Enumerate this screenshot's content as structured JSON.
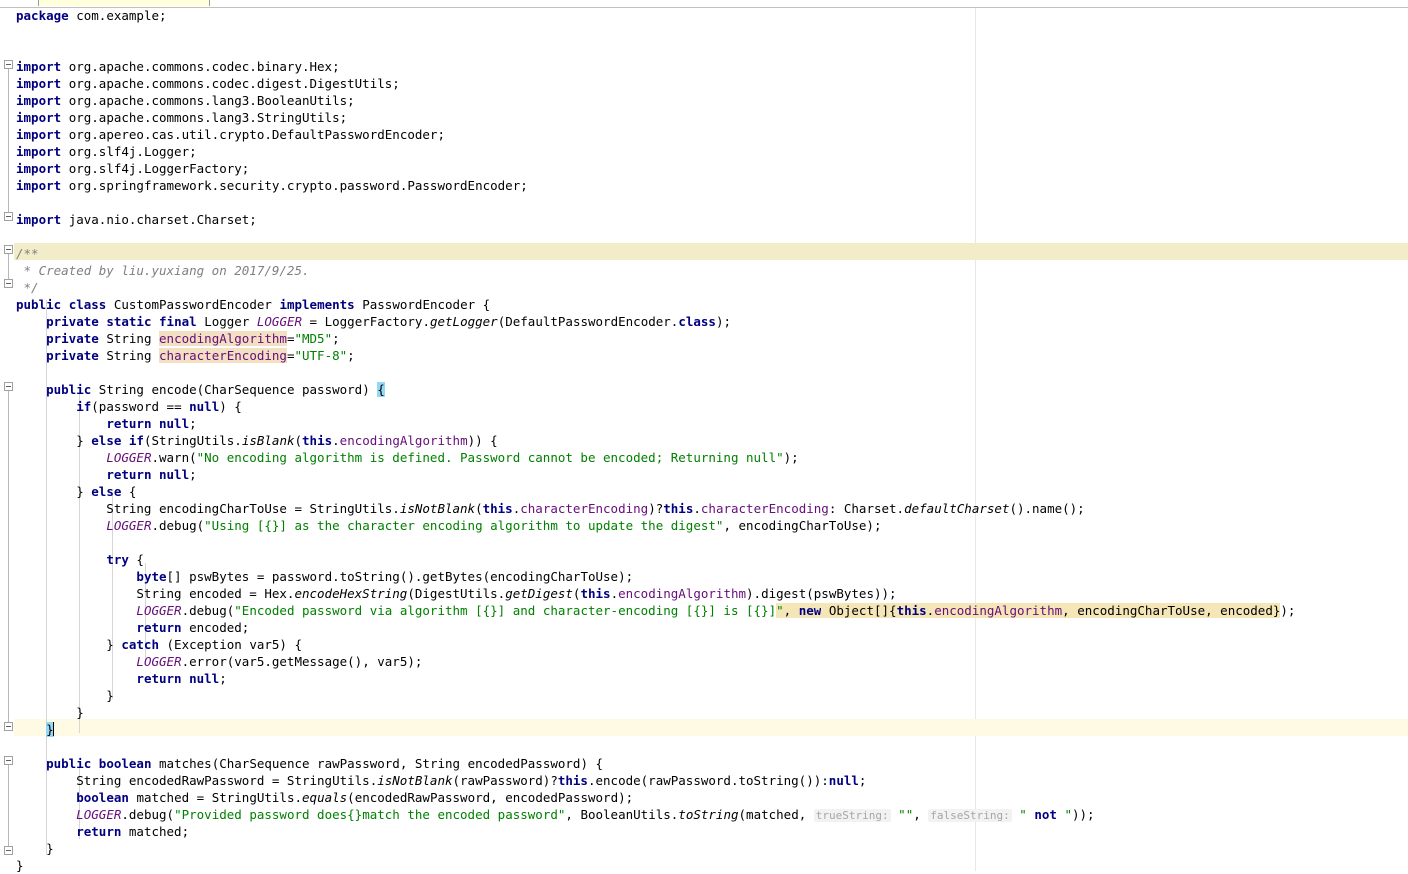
{
  "editor": {
    "app": "IntelliJ IDEA Java Editor",
    "file": "CustomPasswordEncoder.java",
    "language": "java",
    "margin_guide_column_x": 975,
    "colors": {
      "background": "#ffffff",
      "keyword": "#000080",
      "string": "#008000",
      "field": "#660e7a",
      "comment": "#808080",
      "doc_highlight": "#f2ecc9",
      "caret_line": "#fffae3",
      "field_identifier_highlight": "#f3dfc1",
      "selection_highlight": "#f5e6b8",
      "brace_match": "#93d9f5",
      "gutter_fold_line": "#b8b8b8",
      "indent_guide": "#d6d6d6"
    }
  },
  "code": {
    "lines": [
      {
        "id": 1,
        "text": "package com.example;"
      },
      {
        "id": 2,
        "text": ""
      },
      {
        "id": 3,
        "text": ""
      },
      {
        "id": 4,
        "text": "import org.apache.commons.codec.binary.Hex;"
      },
      {
        "id": 5,
        "text": "import org.apache.commons.codec.digest.DigestUtils;"
      },
      {
        "id": 6,
        "text": "import org.apache.commons.lang3.BooleanUtils;"
      },
      {
        "id": 7,
        "text": "import org.apache.commons.lang3.StringUtils;"
      },
      {
        "id": 8,
        "text": "import org.apereo.cas.util.crypto.DefaultPasswordEncoder;"
      },
      {
        "id": 9,
        "text": "import org.slf4j.Logger;"
      },
      {
        "id": 10,
        "text": "import org.slf4j.LoggerFactory;"
      },
      {
        "id": 11,
        "text": "import org.springframework.security.crypto.password.PasswordEncoder;"
      },
      {
        "id": 12,
        "text": ""
      },
      {
        "id": 13,
        "text": "import java.nio.charset.Charset;"
      },
      {
        "id": 14,
        "text": ""
      },
      {
        "id": 15,
        "text": "/**"
      },
      {
        "id": 16,
        "text": " * Created by liu.yuxiang on 2017/9/25."
      },
      {
        "id": 17,
        "text": " */"
      },
      {
        "id": 18,
        "text": "public class CustomPasswordEncoder implements PasswordEncoder {"
      },
      {
        "id": 19,
        "text": "    private static final Logger LOGGER = LoggerFactory.getLogger(DefaultPasswordEncoder.class);"
      },
      {
        "id": 20,
        "text": "    private String encodingAlgorithm=\"MD5\";"
      },
      {
        "id": 21,
        "text": "    private String characterEncoding=\"UTF-8\";"
      },
      {
        "id": 22,
        "text": ""
      },
      {
        "id": 23,
        "text": "    public String encode(CharSequence password) {"
      },
      {
        "id": 24,
        "text": "        if(password == null) {"
      },
      {
        "id": 25,
        "text": "            return null;"
      },
      {
        "id": 26,
        "text": "        } else if(StringUtils.isBlank(this.encodingAlgorithm)) {"
      },
      {
        "id": 27,
        "text": "            LOGGER.warn(\"No encoding algorithm is defined. Password cannot be encoded; Returning null\");"
      },
      {
        "id": 28,
        "text": "            return null;"
      },
      {
        "id": 29,
        "text": "        } else {"
      },
      {
        "id": 30,
        "text": "            String encodingCharToUse = StringUtils.isNotBlank(this.characterEncoding)?this.characterEncoding: Charset.defaultCharset().name();"
      },
      {
        "id": 31,
        "text": "            LOGGER.debug(\"Using [{}] as the character encoding algorithm to update the digest\", encodingCharToUse);"
      },
      {
        "id": 32,
        "text": ""
      },
      {
        "id": 33,
        "text": "            try {"
      },
      {
        "id": 34,
        "text": "                byte[] pswBytes = password.toString().getBytes(encodingCharToUse);"
      },
      {
        "id": 35,
        "text": "                String encoded = Hex.encodeHexString(DigestUtils.getDigest(this.encodingAlgorithm).digest(pswBytes));"
      },
      {
        "id": 36,
        "text": "                LOGGER.debug(\"Encoded password via algorithm [{}] and character-encoding [{}] is [{}]\", new Object[]{this.encodingAlgorithm, encodingCharToUse, encoded});"
      },
      {
        "id": 37,
        "text": "                return encoded;"
      },
      {
        "id": 38,
        "text": "            } catch (Exception var5) {"
      },
      {
        "id": 39,
        "text": "                LOGGER.error(var5.getMessage(), var5);"
      },
      {
        "id": 40,
        "text": "                return null;"
      },
      {
        "id": 41,
        "text": "            }"
      },
      {
        "id": 42,
        "text": "        }"
      },
      {
        "id": 43,
        "text": "    }"
      },
      {
        "id": 44,
        "text": ""
      },
      {
        "id": 45,
        "text": "    public boolean matches(CharSequence rawPassword, String encodedPassword) {"
      },
      {
        "id": 46,
        "text": "        String encodedRawPassword = StringUtils.isNotBlank(rawPassword)?this.encode(rawPassword.toString()):null;"
      },
      {
        "id": 47,
        "text": "        boolean matched = StringUtils.equals(encodedRawPassword, encodedPassword);"
      },
      {
        "id": 48,
        "text": "        LOGGER.debug(\"Provided password does{}match the encoded password\", BooleanUtils.toString(matched, \"\", \" not \"));"
      },
      {
        "id": 49,
        "text": "        return matched;"
      },
      {
        "id": 50,
        "text": "    }"
      },
      {
        "id": 51,
        "text": "}"
      }
    ],
    "parameter_hints": [
      {
        "label": "trueString:",
        "value": "\"\""
      },
      {
        "label": "falseString:",
        "value": "\" not \""
      }
    ],
    "selection_text": "new Object[]{this.encodingAlgorithm, encodingCharToUse, encoded}",
    "highlighted_identifiers": [
      "encodingAlgorithm",
      "characterEncoding"
    ],
    "doc_comment": "/**\n * Created by liu.yuxiang on 2017/9/25.\n */",
    "caret_line_number": 43,
    "matched_braces": [
      "{",
      "}"
    ]
  },
  "tokens": {
    "t_package": "package",
    "t_import": "import",
    "t_public": "public",
    "t_private": "private",
    "t_class": "class",
    "t_implements": "implements",
    "t_static": "static",
    "t_final": "final",
    "t_return": "return",
    "t_null": "null",
    "t_if": "if",
    "t_else": "else",
    "t_try": "try",
    "t_catch": "catch",
    "t_new": "new",
    "t_this": "this",
    "t_byte": "byte",
    "t_boolean": "boolean"
  }
}
